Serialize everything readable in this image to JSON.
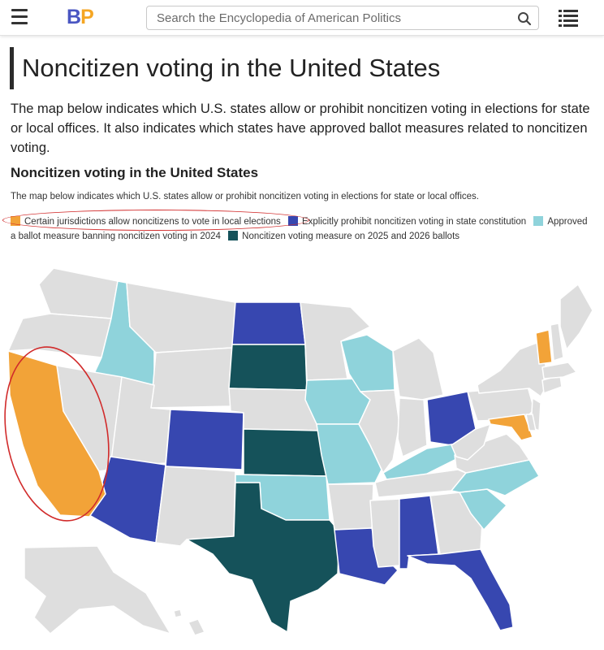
{
  "header": {
    "logo_b": "B",
    "logo_p": "P",
    "search_placeholder": "Search the Encyclopedia of American Politics",
    "menu_icon": "hamburger-menu-icon",
    "search_icon": "magnifier-icon",
    "list_icon": "list-icon"
  },
  "page": {
    "title": "Noncitizen voting in the United States",
    "intro": "The map below indicates which U.S. states allow or prohibit noncitizen voting in elections for state or local offices. It also indicates which states have approved ballot measures related to noncitizen voting."
  },
  "map": {
    "title": "Noncitizen voting in the United States",
    "subtitle": "The map below indicates which U.S. states allow or prohibit noncitizen voting in elections for state or local offices.",
    "legend": [
      {
        "label": "Certain jurisdictions allow noncitizens to vote in local elections",
        "color": "#f2a338"
      },
      {
        "label": "Explicitly prohibit noncitizen voting in state constitution",
        "color": "#3747b0"
      },
      {
        "label": "Approved a ballot measure banning noncitizen voting in 2024",
        "color": "#8fd3db"
      },
      {
        "label": "Noncitizen voting measure on 2025 and 2026 ballots",
        "color": "#15525a"
      }
    ],
    "default_color": "#dedede",
    "border_color": "#ffffff",
    "annotation_color": "#d12b2b"
  }
}
